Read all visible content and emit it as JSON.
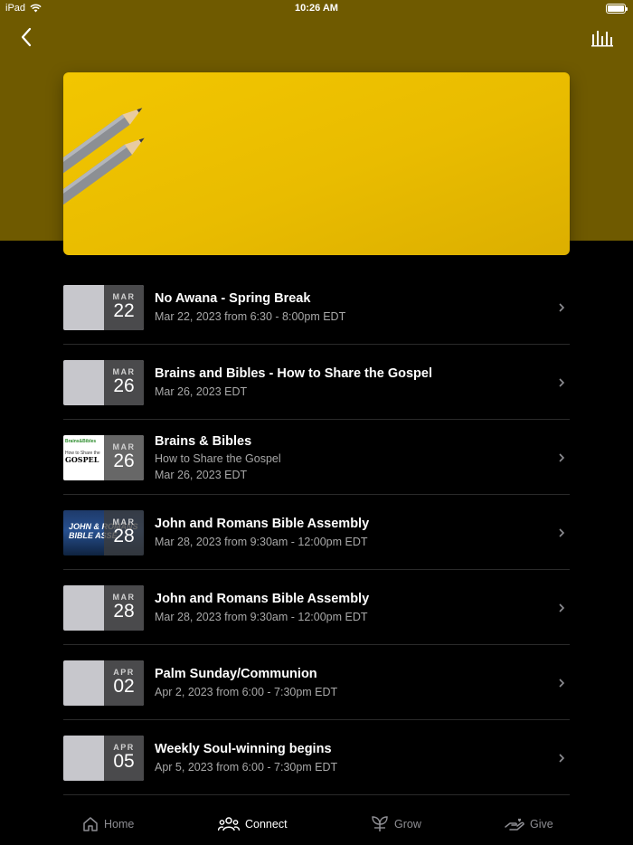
{
  "status_bar": {
    "device": "iPad",
    "time": "10:26 AM"
  },
  "header": {
    "back_icon": "chevron-left-icon",
    "action_icon": "bars-chart-icon"
  },
  "hero": {
    "image": "pencils-on-yellow-paper",
    "color": "#f2c600"
  },
  "events": [
    {
      "title": "No Awana - Spring Break",
      "lines": [
        "Mar 22, 2023 from 6:30 - 8:00pm EDT"
      ],
      "month": "MAR",
      "day": "22",
      "thumb": "plain"
    },
    {
      "title": "Brains and Bibles - How to Share the Gospel",
      "lines": [
        "Mar 26, 2023 EDT"
      ],
      "month": "MAR",
      "day": "26",
      "thumb": "plain"
    },
    {
      "title": "Brains & Bibles",
      "lines": [
        "How to Share the Gospel",
        "Mar 26, 2023 EDT"
      ],
      "month": "MAR",
      "day": "26",
      "thumb": "brains",
      "thumb_text": {
        "logo": "Brains&Bibles",
        "subtitle": "How to Share the",
        "big": "GOSPEL"
      }
    },
    {
      "title": "John and Romans Bible Assembly",
      "lines": [
        "Mar 28, 2023 from 9:30am - 12:00pm EDT"
      ],
      "month": "MAR",
      "day": "28",
      "thumb": "john",
      "thumb_text": {
        "line1": "JOHN & ROMANS",
        "line2": "BIBLE ASSE"
      }
    },
    {
      "title": "John and Romans Bible Assembly",
      "lines": [
        "Mar 28, 2023 from 9:30am - 12:00pm EDT"
      ],
      "month": "MAR",
      "day": "28",
      "thumb": "plain"
    },
    {
      "title": "Palm Sunday/Communion",
      "lines": [
        "Apr 2, 2023 from 6:00 - 7:30pm EDT"
      ],
      "month": "APR",
      "day": "02",
      "thumb": "plain"
    },
    {
      "title": "Weekly Soul-winning begins",
      "lines": [
        "Apr 5, 2023 from 6:00 - 7:30pm EDT"
      ],
      "month": "APR",
      "day": "05",
      "thumb": "plain"
    }
  ],
  "tabs": [
    {
      "label": "Home",
      "icon": "home-icon",
      "active": false
    },
    {
      "label": "Connect",
      "icon": "people-icon",
      "active": true
    },
    {
      "label": "Grow",
      "icon": "sprout-icon",
      "active": false
    },
    {
      "label": "Give",
      "icon": "hand-heart-icon",
      "active": false
    }
  ],
  "colors": {
    "header_band": "#6f5a00",
    "background": "#000000",
    "secondary_text": "#a8a8a8"
  }
}
